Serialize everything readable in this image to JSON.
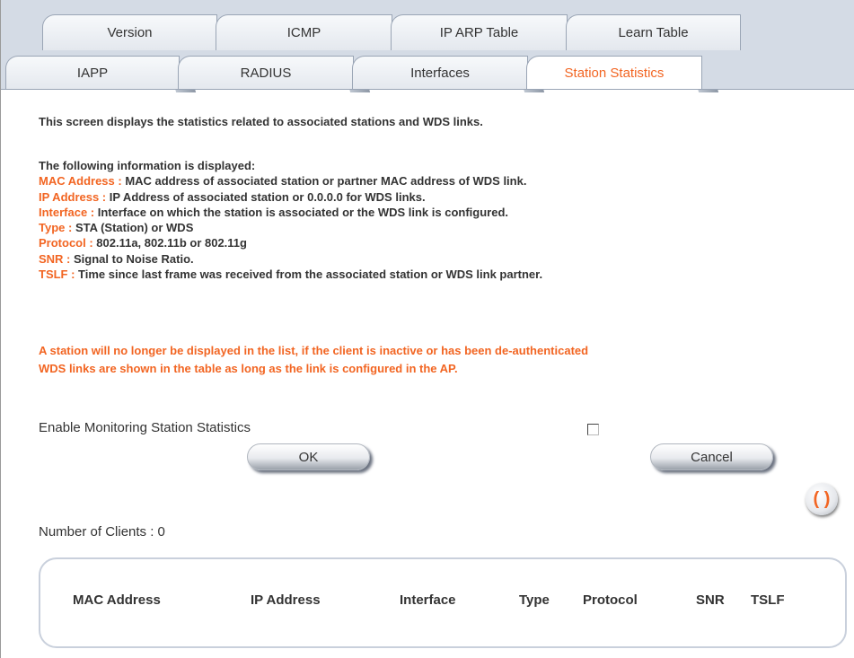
{
  "tabs": {
    "row1": [
      "Version",
      "ICMP",
      "IP ARP Table",
      "Learn Table"
    ],
    "row2": [
      "IAPP",
      "RADIUS",
      "Interfaces",
      "Station Statistics"
    ],
    "active": "Station Statistics"
  },
  "intro": "This screen displays the statistics related to associated stations and WDS links.",
  "info": {
    "heading": "The following information is displayed:",
    "items": [
      {
        "key": "MAC Address :",
        "value": " MAC address of associated station or partner MAC address of WDS link."
      },
      {
        "key": "IP Address :",
        "value": " IP Address of associated station or 0.0.0.0 for WDS links."
      },
      {
        "key": "Interface :",
        "value": " Interface on which the station is associated or the WDS link is configured."
      },
      {
        "key": "Type :",
        "value": " STA (Station) or WDS"
      },
      {
        "key": "Protocol :",
        "value": " 802.11a, 802.11b or 802.11g"
      },
      {
        "key": "SNR :",
        "value": " Signal to Noise Ratio."
      },
      {
        "key": "TSLF :",
        "value": " Time since last frame was received from the associated station or WDS link partner."
      }
    ]
  },
  "warning": {
    "line1": "A station will no longer be displayed in the list, if the client is inactive or has been de-authenticated",
    "line2": "WDS links are shown in the table as long as the link is configured in the AP."
  },
  "form": {
    "enable_label": "Enable Monitoring Station Statistics",
    "enable_checked": false,
    "ok_label": "OK",
    "cancel_label": "Cancel"
  },
  "refresh_icon": "refresh-icon",
  "clients_label": "Number of Clients : 0",
  "table": {
    "columns": [
      "MAC Address",
      "IP Address",
      "Interface",
      "Type",
      "Protocol",
      "SNR",
      "TSLF"
    ],
    "rows": []
  },
  "colors": {
    "accent": "#f26522",
    "text": "#333333",
    "tab_bg": "#d4dbe5"
  }
}
